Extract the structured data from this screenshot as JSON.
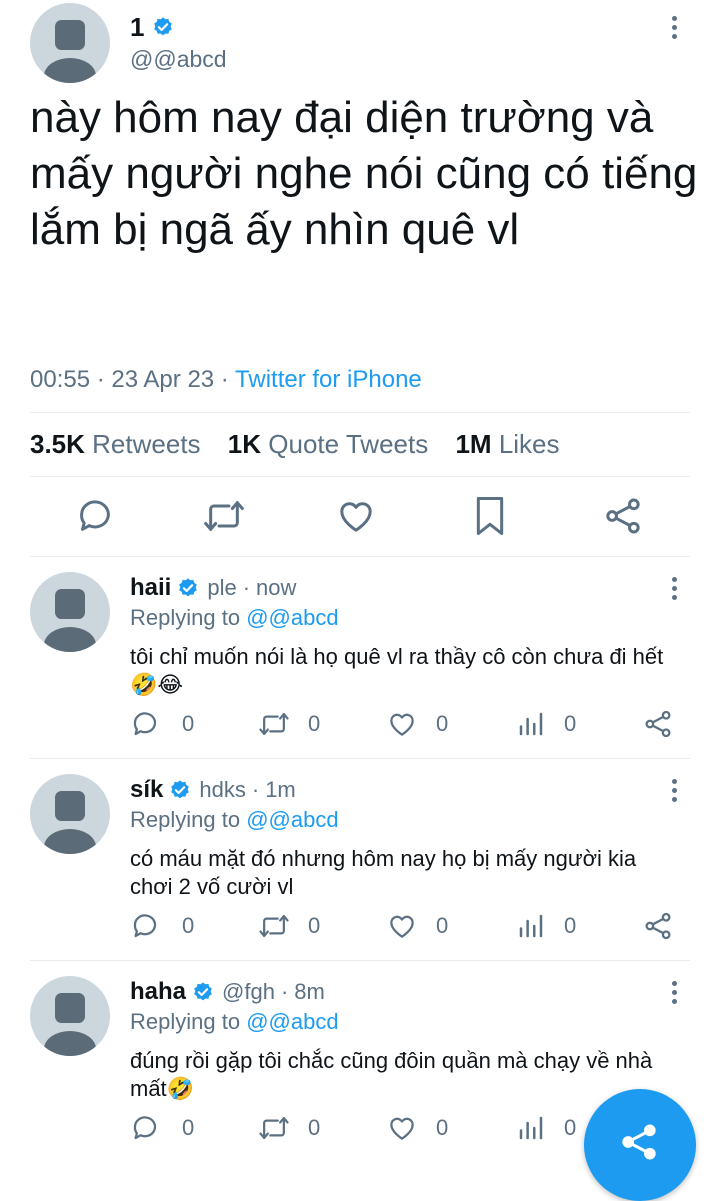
{
  "tweet": {
    "display_name": "1",
    "handle": "@@abcd",
    "text": "này hôm nay đại diện trường và mấy người nghe nói cũng có tiếng lắm bị ngã ấy nhìn quê vl",
    "time": "00:55 · 23 Apr 23 · ",
    "source": "Twitter for iPhone",
    "stats": {
      "retweets_count": "3.5K",
      "retweets_label": "Retweets",
      "quotes_count": "1K",
      "quotes_label": "Quote Tweets",
      "likes_count": "1M",
      "likes_label": "Likes"
    },
    "actions": [
      "reply-icon",
      "retweet-icon",
      "like-icon",
      "bookmark-icon",
      "share-icon"
    ]
  },
  "replies": [
    {
      "name": "haii",
      "handle": "ple",
      "time": "now",
      "replying_prefix": "Replying to ",
      "replying_to": "@@abcd",
      "text": "tôi chỉ muốn nói là họ quê vl ra thầy cô còn chưa đi hết🤣😂",
      "counts": {
        "reply": "0",
        "retweet": "0",
        "like": "0",
        "views": "0"
      }
    },
    {
      "name": "sík",
      "handle": "hdks",
      "time": "1m",
      "replying_prefix": "Replying to ",
      "replying_to": "@@abcd",
      "text": "có máu mặt đó nhưng hôm nay họ bị mấy người kia chơi 2 vố cười vl",
      "counts": {
        "reply": "0",
        "retweet": "0",
        "like": "0",
        "views": "0"
      }
    },
    {
      "name": "haha",
      "handle": "@fgh",
      "time": "8m",
      "replying_prefix": "Replying to ",
      "replying_to": "@@abcd",
      "text": "đúng rồi gặp tôi chắc cũng đôin quần mà chạy về nhà mất🤣",
      "counts": {
        "reply": "0",
        "retweet": "0",
        "like": "0",
        "views": "0"
      }
    }
  ],
  "fab": {
    "icon": "share-icon"
  },
  "colors": {
    "accent": "#1d9bf0",
    "secondary_text": "#5b7083",
    "avatar_bg": "#ccd6dd"
  }
}
